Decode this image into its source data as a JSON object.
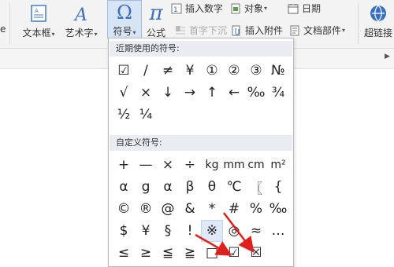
{
  "ribbon": {
    "partial_label": "e",
    "textbox": {
      "label": "文本框",
      "icon": "textbox-icon"
    },
    "wordart": {
      "label": "艺术字",
      "icon": "wordart-icon"
    },
    "symbol": {
      "label": "符号",
      "icon": "omega-icon",
      "glyph": "Ω"
    },
    "formula": {
      "label": "公式",
      "icon": "pi-icon",
      "glyph": "π"
    },
    "insert_number": {
      "label": "插入数字",
      "icon": "insert-number-icon"
    },
    "object": {
      "label": "对象",
      "icon": "object-icon"
    },
    "date": {
      "label": "日期",
      "icon": "calendar-icon"
    },
    "dropcap": {
      "label": "首字下沉",
      "icon": "dropcap-icon"
    },
    "attachment": {
      "label": "插入附件",
      "icon": "paperclip-icon"
    },
    "doc_parts": {
      "label": "文档部件",
      "icon": "doc-parts-icon"
    },
    "hyperlink": {
      "label": "超链接",
      "icon": "hyperlink-icon"
    }
  },
  "symbols_menu": {
    "recent_header": "近期使用的符号:",
    "recent": [
      "☑",
      "/",
      "≠",
      "¥",
      "①",
      "②",
      "③",
      "№",
      "√",
      "×",
      "↓",
      "→",
      "↑",
      "←",
      "‰",
      "¾",
      "½",
      "¼"
    ],
    "custom_header": "自定义符号:",
    "custom": [
      "+",
      "—",
      "×",
      "÷",
      "kg",
      "mm",
      "cm",
      "m²",
      "α",
      "g",
      "α",
      "β",
      "θ",
      "℃",
      "〖",
      "{",
      "©",
      "®",
      "@",
      "&",
      "*",
      "#",
      "%",
      "‰",
      "$",
      "¥",
      "§",
      "!",
      "※",
      "◎",
      "≈",
      "…",
      "≤",
      "≥",
      "≦",
      "≧",
      "□",
      "☑",
      "☒"
    ],
    "hovered_symbol": "※"
  },
  "colors": {
    "ribbon_bg": "#f3f3f3",
    "active_btn": "#d6e4f4",
    "section_head": "#e9edf1",
    "arrow": "#e0201c"
  }
}
